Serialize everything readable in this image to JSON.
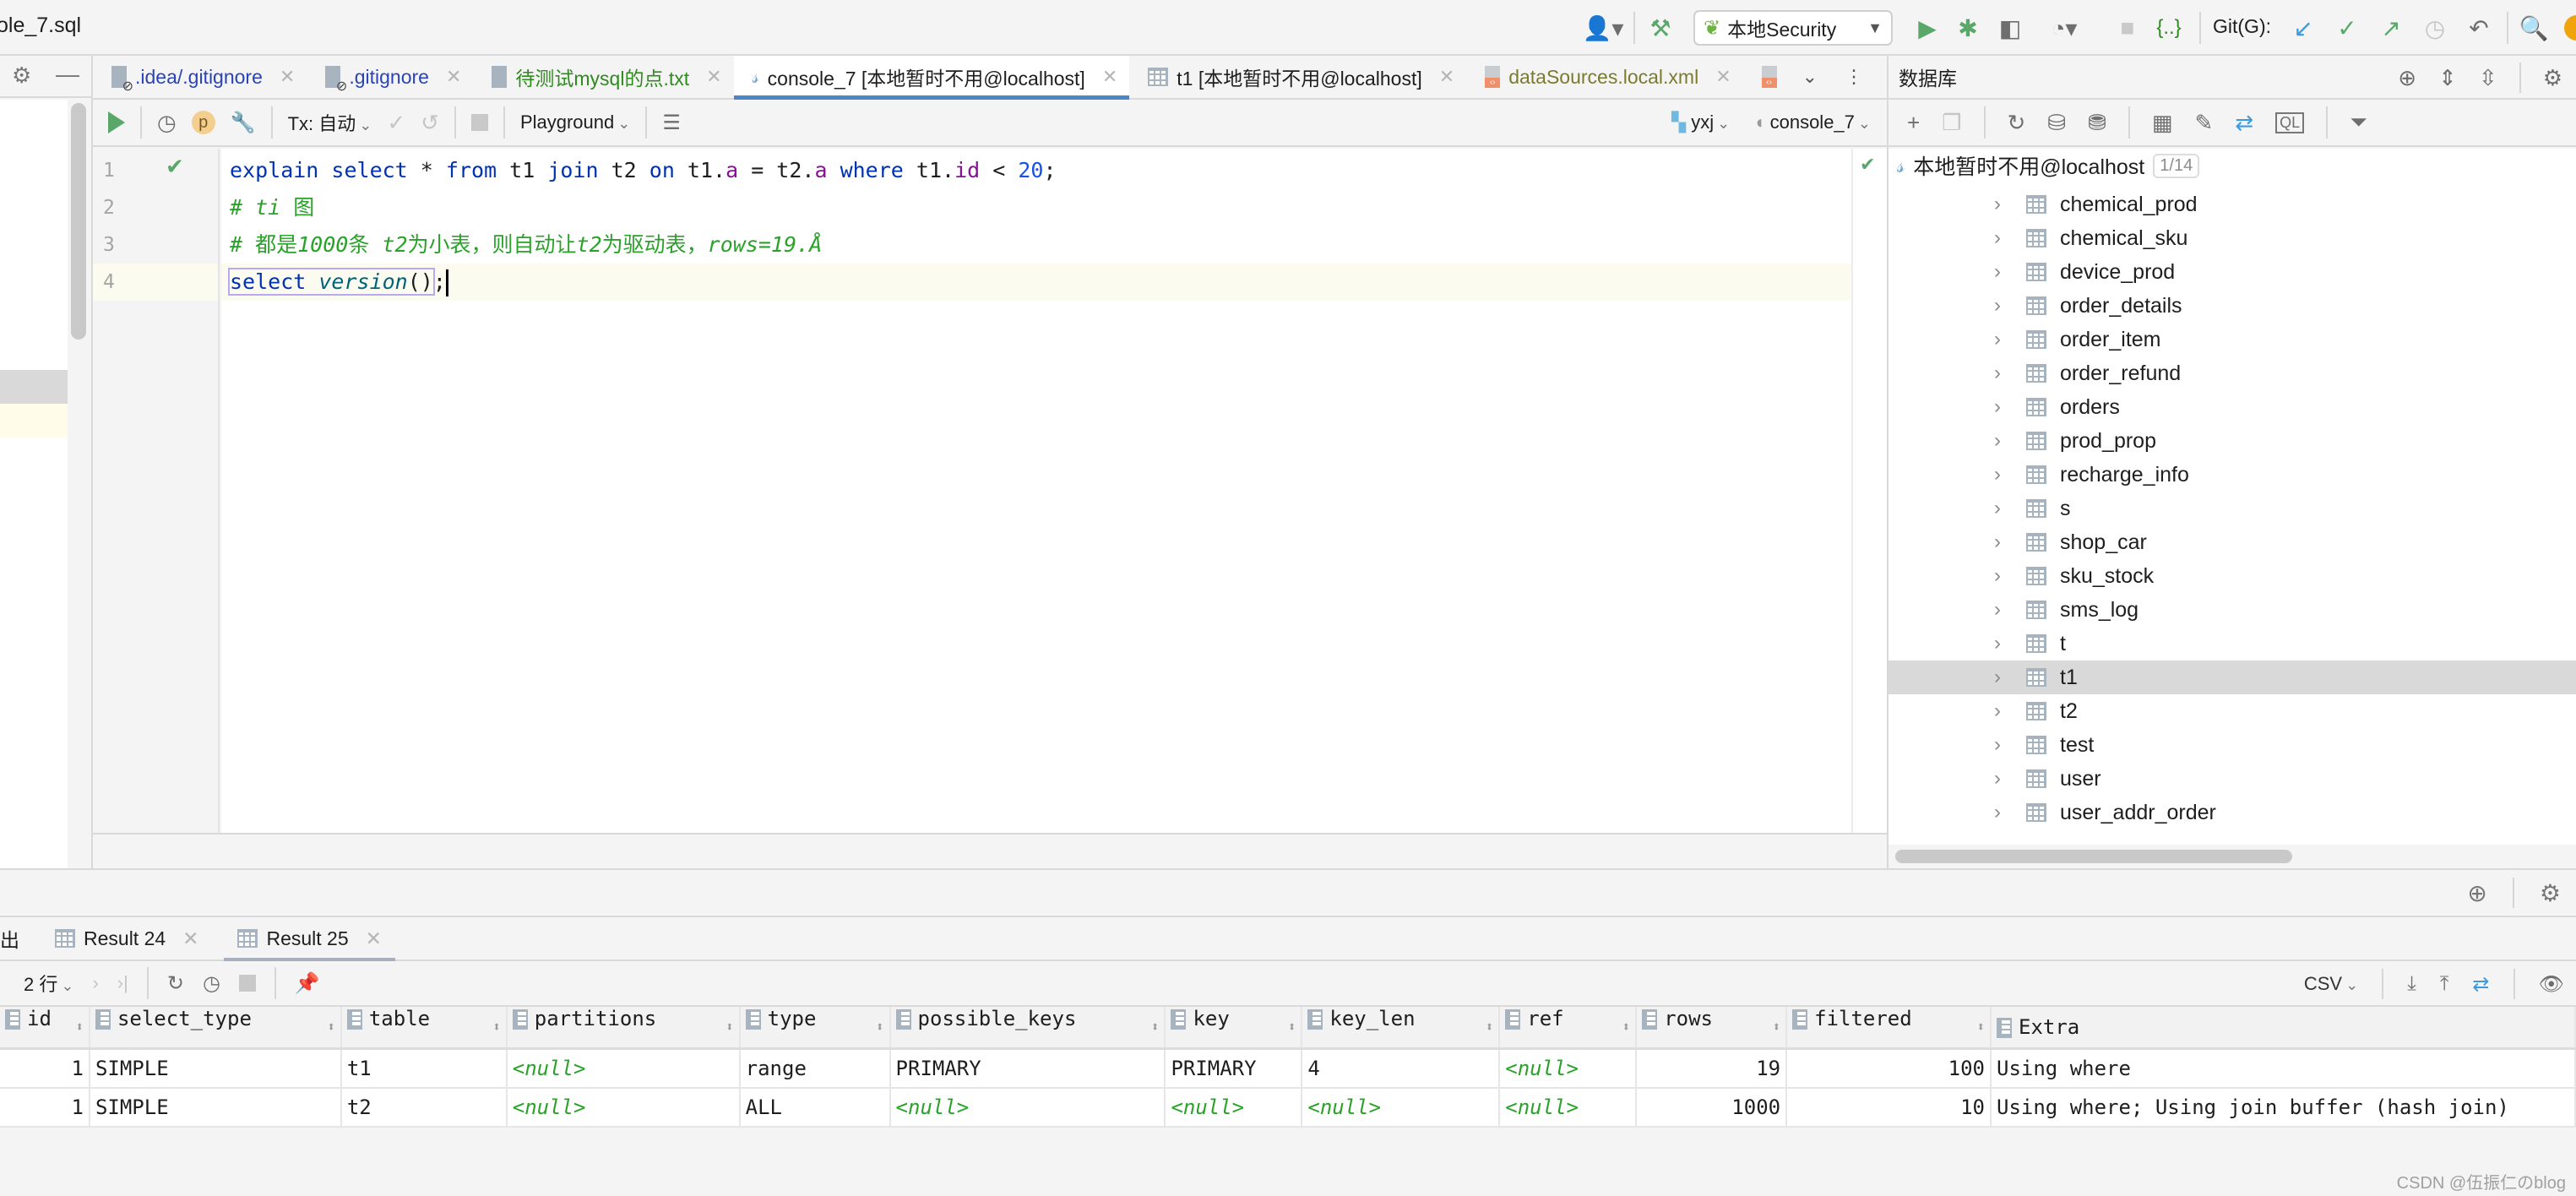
{
  "window": {
    "title": "ole_7.sql"
  },
  "toolbar": {
    "run_config": "本地Security",
    "git_label": "Git(G):",
    "icons": [
      "user-icon",
      "build-hammer-icon",
      "run-icon",
      "debug-icon",
      "coverage-icon",
      "profile-icon",
      "stop-icon",
      "services-icon",
      "git-update-icon",
      "git-commit-icon",
      "git-push-icon",
      "history-icon",
      "rollback-icon",
      "search-icon"
    ]
  },
  "editor_tabs": [
    {
      "label": ".idea/.gitignore",
      "icon": "ignore-file-icon",
      "color": "#2a44b8"
    },
    {
      "label": ".gitignore",
      "icon": "ignore-file-icon",
      "color": "#2a44b8"
    },
    {
      "label": "待测试mysql的点.txt",
      "icon": "text-file-icon",
      "color": "#2f8a1f"
    },
    {
      "label": "console_7 [本地暂时不用@localhost]",
      "icon": "mysql-console-icon",
      "color": "#1e1e1e",
      "active": true
    },
    {
      "label": "t1 [本地暂时不用@localhost]",
      "icon": "table-icon",
      "color": "#1e1e1e"
    },
    {
      "label": "dataSources.local.xml",
      "icon": "xml-file-icon",
      "color": "#7b7b2e"
    }
  ],
  "editor_toolbar": {
    "tx_label": "Tx: 自动",
    "playground_label": "Playground",
    "schema_label": "yxj",
    "session_label": "console_7"
  },
  "editor": {
    "lines": [
      {
        "number": "1",
        "executed": true
      },
      {
        "number": "2"
      },
      {
        "number": "3"
      },
      {
        "number": "4",
        "current": true
      }
    ],
    "line1": {
      "explain": "explain",
      "select": "select",
      "star": " * ",
      "from": "from",
      "t1": " t1 ",
      "join": "join",
      "t2": " t2 ",
      "on": "on",
      "t1a_pre": " t1.",
      "a1": "a",
      "eq": " = t2.",
      "a2": "a",
      "where": " where",
      "t1id_pre": " t1.",
      "id": "id",
      "lt": " < ",
      "num": "20",
      "semi": ";"
    },
    "line2": {
      "hash": "# ti ",
      "zh": "图"
    },
    "line3": {
      "hash": "# ",
      "zh1": "都是",
      "n": "1000",
      "zh2": "条 ",
      "t2a": "t2",
      "zh3": "为小表，则自动让",
      "t2b": "t2",
      "zh4": "为驱动表，",
      "rest": "rows=19.Å"
    },
    "line4": {
      "select": "select",
      "fn": "version",
      "paren": "()",
      "semi": ";"
    }
  },
  "db_panel": {
    "title": "数据库",
    "root": {
      "label": "本地暂时不用@localhost",
      "badge": "1/14"
    },
    "tables": [
      "chemical_prod",
      "chemical_sku",
      "device_prod",
      "order_details",
      "order_item",
      "order_refund",
      "orders",
      "prod_prop",
      "recharge_info",
      "s",
      "shop_car",
      "sku_stock",
      "sms_log",
      "t",
      "t1",
      "t2",
      "test",
      "user",
      "user_addr_order"
    ],
    "selected_table": "t1"
  },
  "results": {
    "tabs": [
      {
        "label": "出"
      },
      {
        "label": "Result 24"
      },
      {
        "label": "Result 25",
        "active": true
      }
    ],
    "row_count_label": "2 行",
    "export_format": "CSV",
    "columns": [
      "id",
      "select_type",
      "table",
      "partitions",
      "type",
      "possible_keys",
      "key",
      "key_len",
      "ref",
      "rows",
      "filtered",
      "Extra"
    ],
    "rows": [
      [
        "1",
        "SIMPLE",
        "t1",
        "<null>",
        "range",
        "PRIMARY",
        "PRIMARY",
        "4",
        "<null>",
        "19",
        "100",
        "Using where"
      ],
      [
        "1",
        "SIMPLE",
        "t2",
        "<null>",
        "ALL",
        "<null>",
        "<null>",
        "<null>",
        "<null>",
        "1000",
        "10",
        "Using where; Using join buffer (hash join)"
      ]
    ]
  },
  "watermark": "CSDN @伍振仁のblog"
}
